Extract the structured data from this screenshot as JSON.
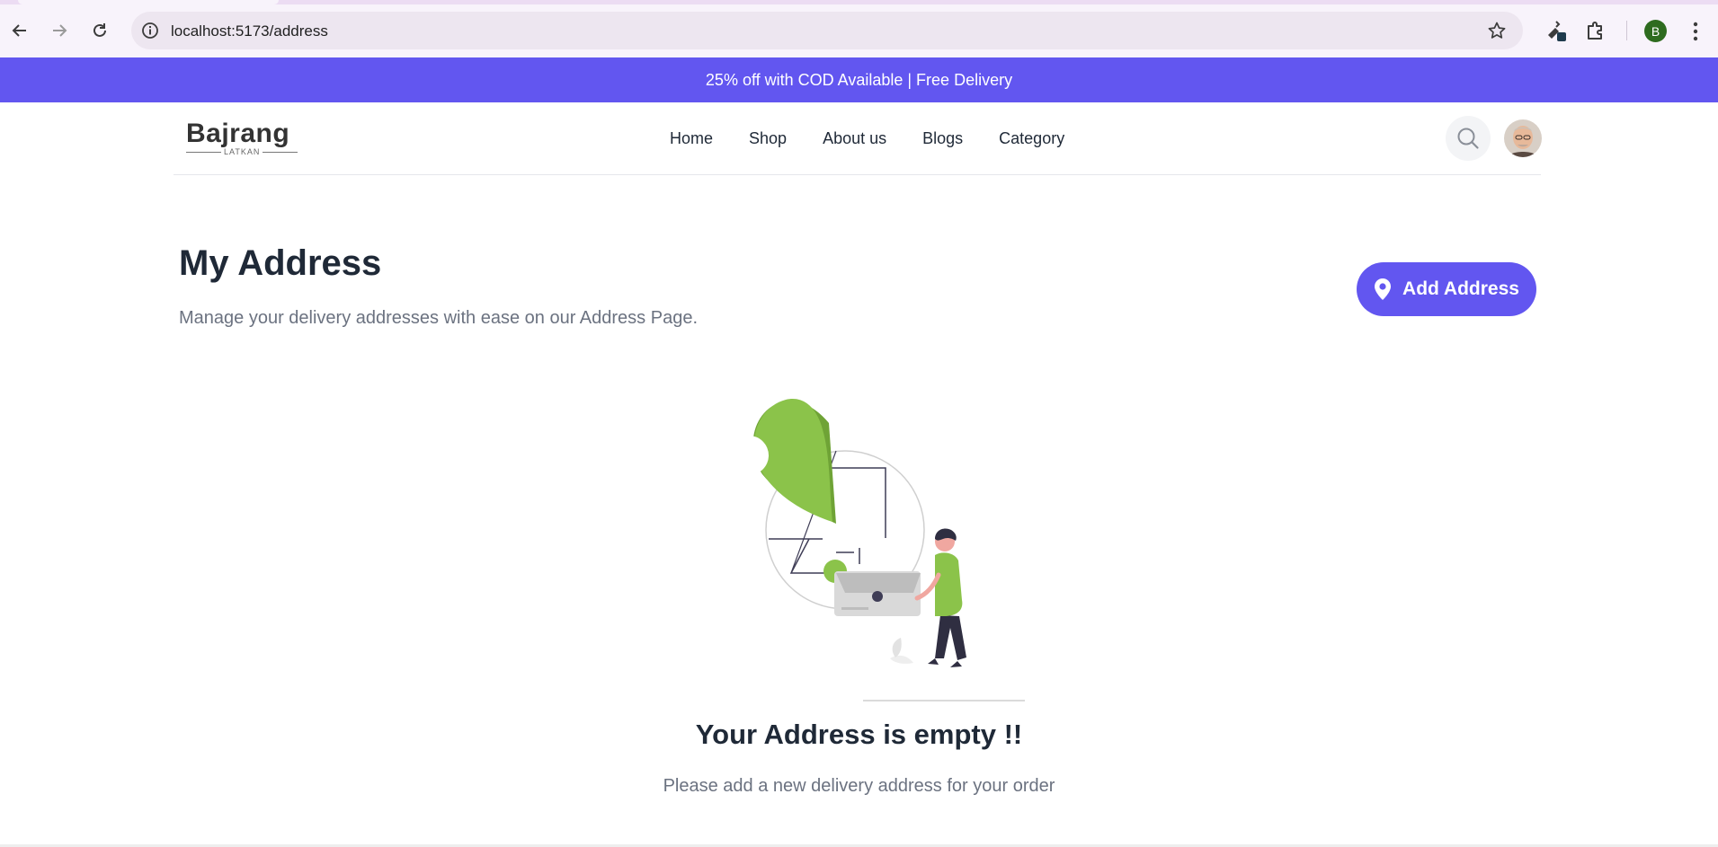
{
  "browser": {
    "url": "localhost:5173/address",
    "profile_initial": "B"
  },
  "promo": {
    "text": "25% off with COD Available | Free Delivery"
  },
  "header": {
    "logo_main": "Bajrang",
    "logo_sub": "LATKAN",
    "nav": [
      "Home",
      "Shop",
      "About us",
      "Blogs",
      "Category"
    ]
  },
  "page": {
    "title": "My Address",
    "subtitle": "Manage your delivery addresses with ease on our Address Page.",
    "add_button": "Add Address"
  },
  "empty_state": {
    "title": "Your Address is empty !!",
    "message": "Please add a new delivery address for your order"
  },
  "colors": {
    "accent": "#6256f0",
    "illustration_green": "#8bc34a"
  },
  "icons": {
    "back": "arrow-left-icon",
    "forward": "arrow-right-icon",
    "reload": "reload-icon",
    "info": "info-icon",
    "star": "star-icon",
    "search": "search-icon",
    "pin": "map-pin-icon"
  }
}
